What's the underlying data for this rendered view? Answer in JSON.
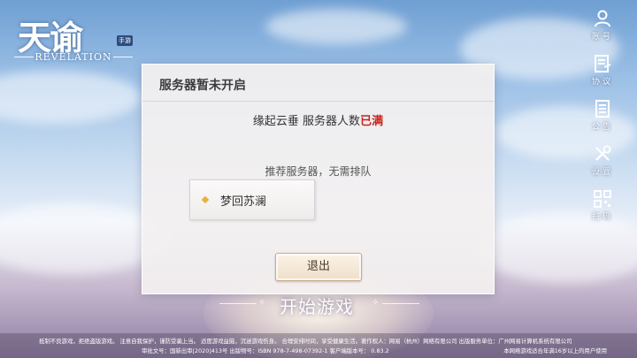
{
  "logo": {
    "title": "天谕",
    "badge": "手游",
    "subtitle": "REVELATION"
  },
  "sidebar": [
    {
      "icon": "account-icon",
      "label": "账号"
    },
    {
      "icon": "agreement-icon",
      "label": "协议"
    },
    {
      "icon": "notice-icon",
      "label": "公告"
    },
    {
      "icon": "settings-icon",
      "label": "设置"
    },
    {
      "icon": "qrcode-icon",
      "label": "扫码"
    }
  ],
  "dialog": {
    "title": "服务器暂未开启",
    "message_prefix": "缘起云垂  服务器人数",
    "message_status": "已满",
    "hint": "推荐服务器，无需排队",
    "recommended_server": "梦回苏澜",
    "exit_label": "退出"
  },
  "start_label": "开始游戏",
  "footer": {
    "line1": "抵制不良游戏，拒绝盗版游戏。 注意自我保护，谨防受骗上当。 适度游戏益脑，沉迷游戏伤身。 合理安排时间，享受健康生活。著作权人：网易（杭州）网络有限公司 出版服务单位：广州网易计算机系统有限公司",
    "line2": "审批文号：国新出审[2020]413号 出版物号：ISBN 978-7-498-07392-1   客户端版本号：  0.83.2",
    "age_notice": "本网络游戏适合年满16岁以上的用户使用"
  },
  "colors": {
    "status_full": "#c8231d",
    "accent_gold": "#e9b03a"
  }
}
